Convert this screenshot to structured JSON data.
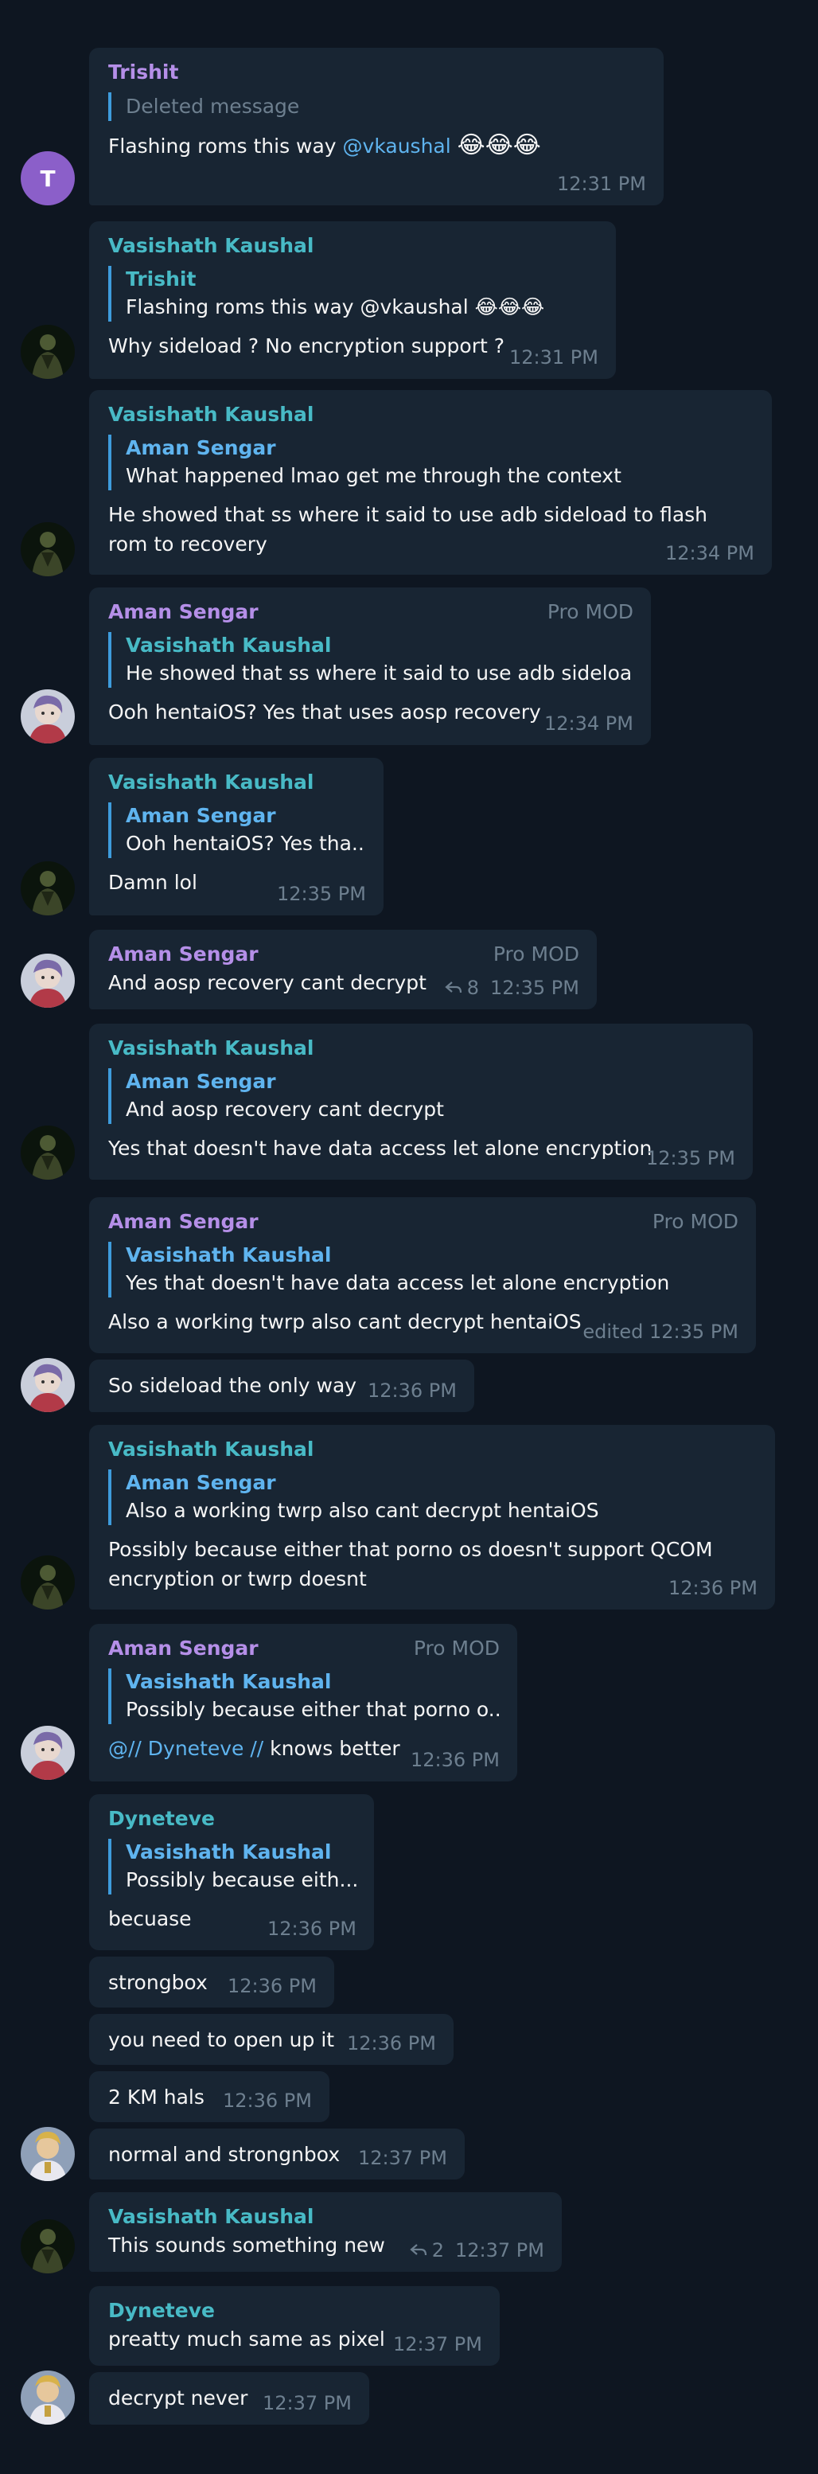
{
  "colors": {
    "background": "#0e1621",
    "bubble": "#182533",
    "quote_bar": "#3e9cdc",
    "name_purple": "#b58fe8",
    "name_teal": "#48bac6",
    "name_blue": "#5fb4ef",
    "meta": "#6d7f8f"
  },
  "avatar_letter": "T",
  "messages": [
    {
      "sender": "Trishit",
      "reply_name": "",
      "reply_text": "Deleted message",
      "text_before": "Flashing roms this way ",
      "mention": "@vkaushal",
      "emoji": "😂😂😂",
      "time": "12:31 PM"
    },
    {
      "sender": "Vasishath Kaushal",
      "reply_name": "Trishit",
      "reply_text": "Flashing roms this way @vkaushal 😂😂😂",
      "text": "Why sideload ? No encryption support ?",
      "time": "12:31 PM"
    },
    {
      "sender": "Vasishath Kaushal",
      "reply_name": "Aman Sengar",
      "reply_text": "What happened lmao get me through the context",
      "text": "He showed that ss where it said to use adb sideload to flash rom to recovery",
      "time": "12:34 PM"
    },
    {
      "sender": "Aman Sengar",
      "role": "Pro MOD",
      "reply_name": "Vasishath Kaushal",
      "reply_text": "He showed that ss where it said to use adb sideloa...",
      "text": "Ooh hentaiOS? Yes that uses aosp recovery",
      "time": "12:34 PM"
    },
    {
      "sender": "Vasishath Kaushal",
      "reply_name": "Aman Sengar",
      "reply_text": "Ooh hentaiOS? Yes tha...",
      "text": "Damn lol",
      "time": "12:35 PM"
    },
    {
      "sender": "Aman Sengar",
      "role": "Pro MOD",
      "text": "And aosp recovery cant decrypt",
      "replies": "8",
      "time": "12:35 PM"
    },
    {
      "sender": "Vasishath Kaushal",
      "reply_name": "Aman Sengar",
      "reply_text": "And aosp recovery cant decrypt",
      "text": "Yes that doesn't have data access let alone encryption",
      "time": "12:35 PM"
    },
    {
      "sender": "Aman Sengar",
      "role": "Pro MOD",
      "reply_name": "Vasishath Kaushal",
      "reply_text": "Yes that doesn't have data access let alone encryption",
      "text": "Also a working twrp also cant decrypt hentaiOS",
      "time": "edited 12:35 PM"
    },
    {
      "text": "So sideload the only way",
      "time": "12:36 PM"
    },
    {
      "sender": "Vasishath Kaushal",
      "reply_name": "Aman Sengar",
      "reply_text": "Also a working twrp also cant decrypt hentaiOS",
      "text": "Possibly because either that porno os doesn't support QCOM encryption or twrp doesnt",
      "time": "12:36 PM"
    },
    {
      "sender": "Aman Sengar",
      "role": "Pro MOD",
      "reply_name": "Vasishath Kaushal",
      "reply_text": "Possibly because either that porno o...",
      "mention": "@// Dyneteve //",
      "text_after": " knows better",
      "time": "12:36 PM"
    },
    {
      "sender": "Dyneteve",
      "reply_name": "Vasishath Kaushal",
      "reply_text": "Possibly because eith...",
      "text": "becuase",
      "time": "12:36 PM"
    },
    {
      "text": "strongbox",
      "time": "12:36 PM"
    },
    {
      "text": "you need to open up it",
      "time": "12:36 PM"
    },
    {
      "text": "2 KM hals",
      "time": "12:36 PM"
    },
    {
      "text": "normal and strongnbox",
      "time": "12:37 PM"
    },
    {
      "sender": "Vasishath Kaushal",
      "text": "This sounds something new",
      "replies": "2",
      "time": "12:37 PM"
    },
    {
      "sender": "Dyneteve",
      "text": "preatty much same as pixel",
      "time": "12:37 PM"
    },
    {
      "text": "decrypt never",
      "time": "12:37 PM"
    }
  ]
}
